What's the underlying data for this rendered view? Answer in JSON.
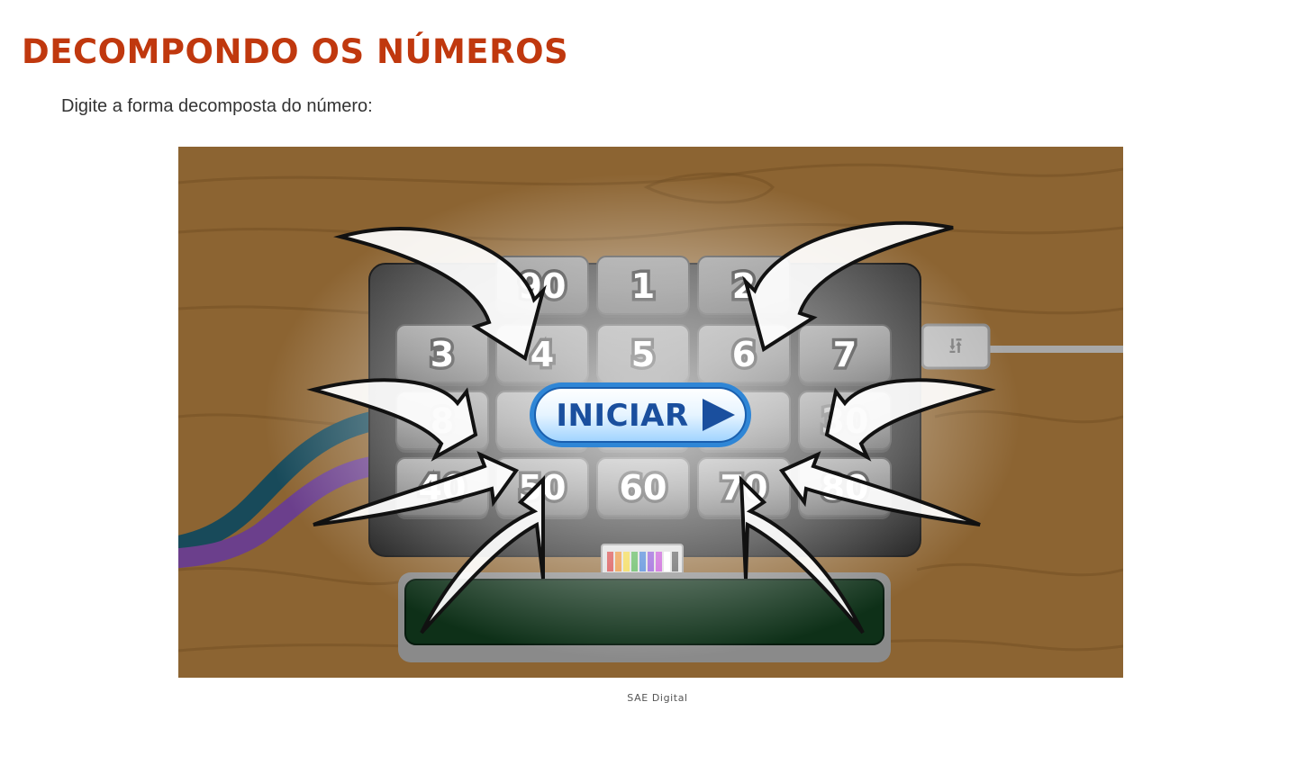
{
  "header": {
    "title": "DECOMPONDO OS NÚMEROS",
    "instruction": "Digite a forma decomposta do número:"
  },
  "game": {
    "keypad": {
      "rows": [
        [
          "90",
          "1",
          "2"
        ],
        [
          "3",
          "4",
          "5",
          "6",
          "7"
        ],
        [
          "8",
          "",
          "",
          "",
          "30"
        ],
        [
          "40",
          "50",
          "60",
          "70",
          "80"
        ]
      ]
    },
    "start_button_label": "INICIAR",
    "display_value": "",
    "ribbon_colors": [
      "#d43a3a",
      "#e98a2b",
      "#f1d43a",
      "#4cb04a",
      "#3a78d4",
      "#8a4ad4",
      "#c24ad4",
      "#ffffff",
      "#555555"
    ]
  },
  "footer": {
    "credit": "SAE Digital"
  }
}
